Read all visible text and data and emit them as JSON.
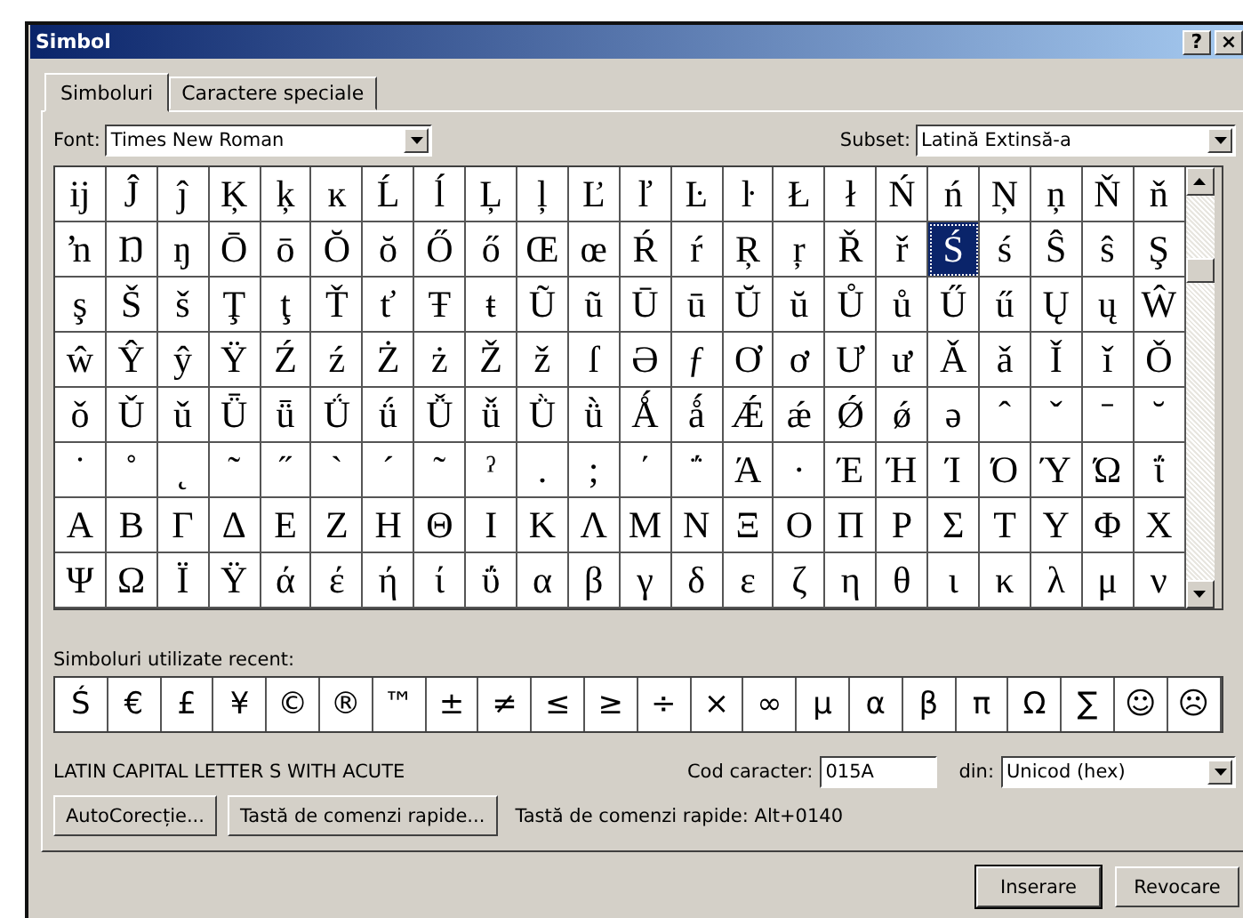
{
  "window": {
    "title": "Simbol",
    "help_button": "?",
    "close_button": "×"
  },
  "tabs": [
    {
      "label": "Simboluri",
      "selected": true
    },
    {
      "label": "Caractere speciale",
      "selected": false
    }
  ],
  "font": {
    "label": "Font:",
    "value": "Times New Roman"
  },
  "subset": {
    "label": "Subset:",
    "value": "Latină Extinsă-a"
  },
  "grid": [
    [
      {
        "char": "ĳ",
        "selected": false
      },
      {
        "char": "Ĵ",
        "selected": false
      },
      {
        "char": "ĵ",
        "selected": false
      },
      {
        "char": "Ķ",
        "selected": false
      },
      {
        "char": "ķ",
        "selected": false
      },
      {
        "char": "ĸ",
        "selected": false
      },
      {
        "char": "Ĺ",
        "selected": false
      },
      {
        "char": "ĺ",
        "selected": false
      },
      {
        "char": "Ļ",
        "selected": false
      },
      {
        "char": "ļ",
        "selected": false
      },
      {
        "char": "Ľ",
        "selected": false
      },
      {
        "char": "ľ",
        "selected": false
      },
      {
        "char": "Ŀ",
        "selected": false
      },
      {
        "char": "ŀ",
        "selected": false
      },
      {
        "char": "Ł",
        "selected": false
      },
      {
        "char": "ł",
        "selected": false
      },
      {
        "char": "Ń",
        "selected": false
      },
      {
        "char": "ń",
        "selected": false
      },
      {
        "char": "Ņ",
        "selected": false
      },
      {
        "char": "ņ",
        "selected": false
      },
      {
        "char": "Ň",
        "selected": false
      },
      {
        "char": "ň",
        "selected": false
      }
    ],
    [
      {
        "char": "ŉ",
        "selected": false
      },
      {
        "char": "Ŋ",
        "selected": false
      },
      {
        "char": "ŋ",
        "selected": false
      },
      {
        "char": "Ō",
        "selected": false
      },
      {
        "char": "ō",
        "selected": false
      },
      {
        "char": "Ŏ",
        "selected": false
      },
      {
        "char": "ŏ",
        "selected": false
      },
      {
        "char": "Ő",
        "selected": false
      },
      {
        "char": "ő",
        "selected": false
      },
      {
        "char": "Œ",
        "selected": false
      },
      {
        "char": "œ",
        "selected": false
      },
      {
        "char": "Ŕ",
        "selected": false
      },
      {
        "char": "ŕ",
        "selected": false
      },
      {
        "char": "Ŗ",
        "selected": false
      },
      {
        "char": "ŗ",
        "selected": false
      },
      {
        "char": "Ř",
        "selected": false
      },
      {
        "char": "ř",
        "selected": false
      },
      {
        "char": "Ś",
        "selected": true
      },
      {
        "char": "ś",
        "selected": false
      },
      {
        "char": "Ŝ",
        "selected": false
      },
      {
        "char": "ŝ",
        "selected": false
      },
      {
        "char": "Ş",
        "selected": false
      }
    ],
    [
      {
        "char": "ş",
        "selected": false
      },
      {
        "char": "Š",
        "selected": false
      },
      {
        "char": "š",
        "selected": false
      },
      {
        "char": "Ţ",
        "selected": false
      },
      {
        "char": "ţ",
        "selected": false
      },
      {
        "char": "Ť",
        "selected": false
      },
      {
        "char": "ť",
        "selected": false
      },
      {
        "char": "Ŧ",
        "selected": false
      },
      {
        "char": "ŧ",
        "selected": false
      },
      {
        "char": "Ũ",
        "selected": false
      },
      {
        "char": "ũ",
        "selected": false
      },
      {
        "char": "Ū",
        "selected": false
      },
      {
        "char": "ū",
        "selected": false
      },
      {
        "char": "Ŭ",
        "selected": false
      },
      {
        "char": "ŭ",
        "selected": false
      },
      {
        "char": "Ů",
        "selected": false
      },
      {
        "char": "ů",
        "selected": false
      },
      {
        "char": "Ű",
        "selected": false
      },
      {
        "char": "ű",
        "selected": false
      },
      {
        "char": "Ų",
        "selected": false
      },
      {
        "char": "ų",
        "selected": false
      },
      {
        "char": "Ŵ",
        "selected": false
      }
    ],
    [
      {
        "char": "ŵ",
        "selected": false
      },
      {
        "char": "Ŷ",
        "selected": false
      },
      {
        "char": "ŷ",
        "selected": false
      },
      {
        "char": "Ÿ",
        "selected": false
      },
      {
        "char": "Ź",
        "selected": false
      },
      {
        "char": "ź",
        "selected": false
      },
      {
        "char": "Ż",
        "selected": false
      },
      {
        "char": "ż",
        "selected": false
      },
      {
        "char": "Ž",
        "selected": false
      },
      {
        "char": "ž",
        "selected": false
      },
      {
        "char": "ſ",
        "selected": false
      },
      {
        "char": "Ə",
        "selected": false
      },
      {
        "char": "ƒ",
        "selected": false
      },
      {
        "char": "Ơ",
        "selected": false
      },
      {
        "char": "ơ",
        "selected": false
      },
      {
        "char": "Ư",
        "selected": false
      },
      {
        "char": "ư",
        "selected": false
      },
      {
        "char": "Ǎ",
        "selected": false
      },
      {
        "char": "ǎ",
        "selected": false
      },
      {
        "char": "Ǐ",
        "selected": false
      },
      {
        "char": "ǐ",
        "selected": false
      },
      {
        "char": "Ǒ",
        "selected": false
      }
    ],
    [
      {
        "char": "ǒ",
        "selected": false
      },
      {
        "char": "Ǔ",
        "selected": false
      },
      {
        "char": "ǔ",
        "selected": false
      },
      {
        "char": "Ǖ",
        "selected": false
      },
      {
        "char": "ǖ",
        "selected": false
      },
      {
        "char": "Ǘ",
        "selected": false
      },
      {
        "char": "ǘ",
        "selected": false
      },
      {
        "char": "Ǚ",
        "selected": false
      },
      {
        "char": "ǚ",
        "selected": false
      },
      {
        "char": "Ǜ",
        "selected": false
      },
      {
        "char": "ǜ",
        "selected": false
      },
      {
        "char": "Ǻ",
        "selected": false
      },
      {
        "char": "ǻ",
        "selected": false
      },
      {
        "char": "Ǽ",
        "selected": false
      },
      {
        "char": "ǽ",
        "selected": false
      },
      {
        "char": "Ǿ",
        "selected": false
      },
      {
        "char": "ǿ",
        "selected": false
      },
      {
        "char": "ə",
        "selected": false
      },
      {
        "char": "ˆ",
        "selected": false
      },
      {
        "char": "ˇ",
        "selected": false
      },
      {
        "char": "ˉ",
        "selected": false
      },
      {
        "char": "˘",
        "selected": false
      }
    ],
    [
      {
        "char": "˙",
        "selected": false
      },
      {
        "char": "˚",
        "selected": false
      },
      {
        "char": "˛",
        "selected": false
      },
      {
        "char": "˜",
        "selected": false
      },
      {
        "char": "˝",
        "selected": false
      },
      {
        "char": "ˋ",
        "selected": false
      },
      {
        "char": "ˊ",
        "selected": false
      },
      {
        "char": "˜",
        "selected": false
      },
      {
        "char": "ˀ",
        "selected": false
      },
      {
        "char": ".",
        "selected": false
      },
      {
        "char": ";",
        "selected": false
      },
      {
        "char": "΄",
        "selected": false
      },
      {
        "char": "΅",
        "selected": false
      },
      {
        "char": "Ά",
        "selected": false
      },
      {
        "char": "·",
        "selected": false
      },
      {
        "char": "Έ",
        "selected": false
      },
      {
        "char": "Ή",
        "selected": false
      },
      {
        "char": "Ί",
        "selected": false
      },
      {
        "char": "Ό",
        "selected": false
      },
      {
        "char": "Ύ",
        "selected": false
      },
      {
        "char": "Ώ",
        "selected": false
      },
      {
        "char": "ΐ",
        "selected": false
      }
    ],
    [
      {
        "char": "Α",
        "selected": false
      },
      {
        "char": "Β",
        "selected": false
      },
      {
        "char": "Γ",
        "selected": false
      },
      {
        "char": "Δ",
        "selected": false
      },
      {
        "char": "Ε",
        "selected": false
      },
      {
        "char": "Ζ",
        "selected": false
      },
      {
        "char": "Η",
        "selected": false
      },
      {
        "char": "Θ",
        "selected": false
      },
      {
        "char": "Ι",
        "selected": false
      },
      {
        "char": "Κ",
        "selected": false
      },
      {
        "char": "Λ",
        "selected": false
      },
      {
        "char": "Μ",
        "selected": false
      },
      {
        "char": "Ν",
        "selected": false
      },
      {
        "char": "Ξ",
        "selected": false
      },
      {
        "char": "Ο",
        "selected": false
      },
      {
        "char": "Π",
        "selected": false
      },
      {
        "char": "Ρ",
        "selected": false
      },
      {
        "char": "Σ",
        "selected": false
      },
      {
        "char": "Τ",
        "selected": false
      },
      {
        "char": "Υ",
        "selected": false
      },
      {
        "char": "Φ",
        "selected": false
      },
      {
        "char": "Χ",
        "selected": false
      }
    ],
    [
      {
        "char": "Ψ",
        "selected": false
      },
      {
        "char": "Ω",
        "selected": false
      },
      {
        "char": "Ϊ",
        "selected": false
      },
      {
        "char": "Ϋ",
        "selected": false
      },
      {
        "char": "ά",
        "selected": false
      },
      {
        "char": "έ",
        "selected": false
      },
      {
        "char": "ή",
        "selected": false
      },
      {
        "char": "ί",
        "selected": false
      },
      {
        "char": "ΰ",
        "selected": false
      },
      {
        "char": "α",
        "selected": false
      },
      {
        "char": "β",
        "selected": false
      },
      {
        "char": "γ",
        "selected": false
      },
      {
        "char": "δ",
        "selected": false
      },
      {
        "char": "ε",
        "selected": false
      },
      {
        "char": "ζ",
        "selected": false
      },
      {
        "char": "η",
        "selected": false
      },
      {
        "char": "θ",
        "selected": false
      },
      {
        "char": "ι",
        "selected": false
      },
      {
        "char": "κ",
        "selected": false
      },
      {
        "char": "λ",
        "selected": false
      },
      {
        "char": "μ",
        "selected": false
      },
      {
        "char": "ν",
        "selected": false
      }
    ]
  ],
  "recent": {
    "label": "Simboluri utilizate recent:",
    "symbols": [
      "Ś",
      "€",
      "£",
      "¥",
      "©",
      "®",
      "™",
      "±",
      "≠",
      "≤",
      "≥",
      "÷",
      "×",
      "∞",
      "μ",
      "α",
      "β",
      "π",
      "Ω",
      "∑",
      "☺",
      "☹"
    ]
  },
  "character_name": "LATIN CAPITAL LETTER S WITH ACUTE",
  "character_code": {
    "label": "Cod caracter:",
    "value": "015A"
  },
  "from": {
    "label": "din:",
    "value": "Unicod (hex)"
  },
  "buttons": [
    {
      "label": "AutoCorecție..."
    },
    {
      "label": "Tastă de comenzi rapide..."
    }
  ],
  "shortcut": "Tastă de comenzi rapide: Alt+0140",
  "footer_buttons": [
    {
      "label": "Inserare",
      "default": true
    },
    {
      "label": "Revocare",
      "default": false
    }
  ]
}
